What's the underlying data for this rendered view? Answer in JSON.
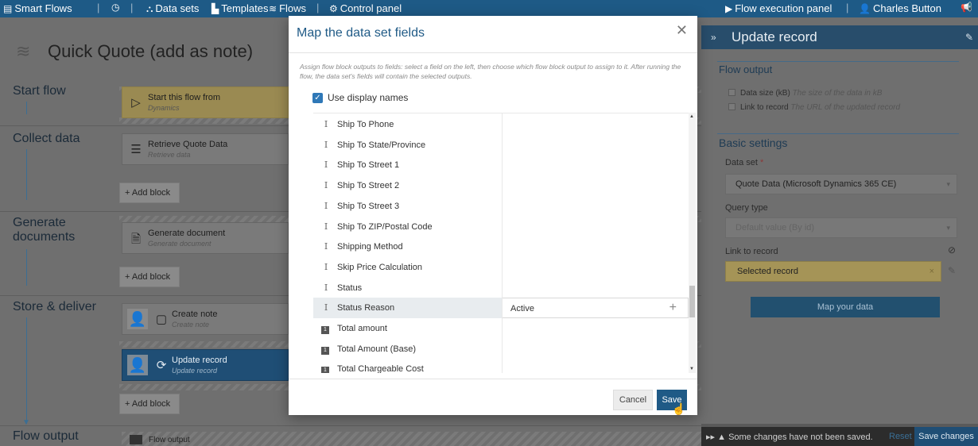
{
  "topbar": {
    "app": "Smart Flows",
    "datasets": "Data sets",
    "templates": "Templates",
    "flows": "Flows",
    "control_panel": "Control panel",
    "execution_panel": "Flow execution panel",
    "user": "Charles Button"
  },
  "flow": {
    "title": "Quick Quote (add as note)",
    "stages": [
      {
        "label": "Start flow"
      },
      {
        "label": "Collect data"
      },
      {
        "label": "Generate documents"
      },
      {
        "label": "Store & deliver"
      }
    ],
    "blocks": {
      "start": {
        "title": "Start this flow from",
        "sub": "Dynamics"
      },
      "retrieve": {
        "title": "Retrieve Quote Data",
        "sub": "Retrieve data"
      },
      "generate": {
        "title": "Generate document",
        "sub": "Generate document"
      },
      "note": {
        "title": "Create note",
        "sub": "Create note"
      },
      "update": {
        "title": "Update record",
        "sub": "Update record"
      }
    },
    "add_block": "+ Add block",
    "flow_output_label": "Flow output",
    "flow_output_block": "Flow output"
  },
  "right_panel": {
    "title": "Update record",
    "flow_output_section": "Flow output",
    "outputs": [
      {
        "name": "Data size (kB)",
        "desc": "The size of the data in kB"
      },
      {
        "name": "Link to record",
        "desc": "The URL of the updated record"
      }
    ],
    "basic_settings": "Basic settings",
    "dataset_label": "Data set",
    "required_mark": "*",
    "dataset_value": "Quote Data (Microsoft Dynamics 365 CE)",
    "query_type_label": "Query type",
    "query_type_value": "Default value (By id)",
    "link_label": "Link to record",
    "link_value": "Selected record",
    "map_button": "Map your data"
  },
  "status_bar": {
    "message": "Some changes have not been saved.",
    "reset": "Reset",
    "save_changes": "Save changes"
  },
  "modal": {
    "title": "Map the data set fields",
    "description": "Assign flow block outputs to fields: select a field on the left, then choose which flow block output to assign to it. After running the flow, the data set's fields will contain the selected outputs.",
    "use_display_names": "Use display names",
    "fields": [
      {
        "type": "text",
        "name": "Ship To Phone",
        "value": ""
      },
      {
        "type": "text",
        "name": "Ship To State/Province",
        "value": ""
      },
      {
        "type": "text",
        "name": "Ship To Street 1",
        "value": ""
      },
      {
        "type": "text",
        "name": "Ship To Street 2",
        "value": ""
      },
      {
        "type": "text",
        "name": "Ship To Street 3",
        "value": ""
      },
      {
        "type": "text",
        "name": "Ship To ZIP/Postal Code",
        "value": ""
      },
      {
        "type": "text",
        "name": "Shipping Method",
        "value": ""
      },
      {
        "type": "text",
        "name": "Skip Price Calculation",
        "value": ""
      },
      {
        "type": "text",
        "name": "Status",
        "value": ""
      },
      {
        "type": "text",
        "name": "Status Reason",
        "value": "Active",
        "active": true
      },
      {
        "type": "number",
        "name": "Total amount",
        "value": ""
      },
      {
        "type": "number",
        "name": "Total Amount (Base)",
        "value": ""
      },
      {
        "type": "number",
        "name": "Total Chargeable Cost",
        "value": ""
      }
    ],
    "type_glyphs": {
      "text": "I",
      "number": "1"
    },
    "cancel": "Cancel",
    "save": "Save"
  }
}
